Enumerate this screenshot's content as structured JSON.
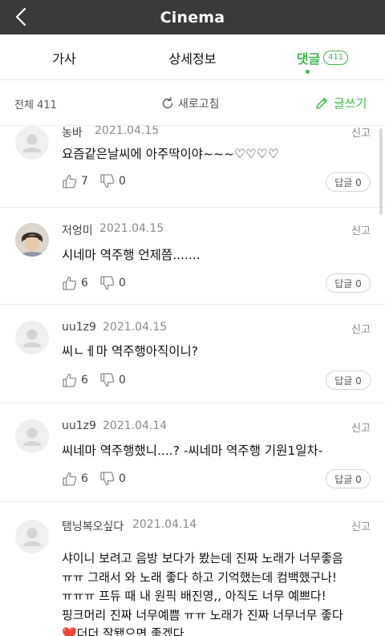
{
  "header": {
    "title": "Cinema"
  },
  "tabs": [
    {
      "label": "가사"
    },
    {
      "label": "상세정보"
    },
    {
      "label": "댓글",
      "count": "411"
    }
  ],
  "toolbar": {
    "total": "전체 411",
    "refresh": "새로고침",
    "write": "글쓰기"
  },
  "colors": {
    "accent": "#3dbb4a",
    "header_bg": "#3a3a3a"
  },
  "comments": [
    {
      "nick": "농바",
      "date": "2021.04.15",
      "report": "신고",
      "text": "요즘같은날씨에 아주딱이야~~~♡♡♡♡",
      "likes": "7",
      "dislikes": "0",
      "reply": "답글 0",
      "avatar": "default-avatar-icon"
    },
    {
      "nick": "저엉미",
      "date": "2021.04.15",
      "report": "신고",
      "text": "시네마 역주행 언제쯤.......",
      "likes": "6",
      "dislikes": "0",
      "reply": "답글 0",
      "avatar": "profile-photo"
    },
    {
      "nick": "uu1z9",
      "date": "2021.04.15",
      "report": "신고",
      "text": "씨ㄴㅔ마 역주행아직이니?",
      "likes": "6",
      "dislikes": "0",
      "reply": "답글 0",
      "avatar": "default-avatar-icon"
    },
    {
      "nick": "uu1z9",
      "date": "2021.04.14",
      "report": "신고",
      "text": "씨네마 역주행했니....? -씨네마 역주행 기원1일차-",
      "likes": "6",
      "dislikes": "0",
      "reply": "답글 0",
      "avatar": "default-avatar-icon"
    },
    {
      "nick": "탬닝복오싶다",
      "date": "2021.04.14",
      "report": "신고",
      "text_lines": [
        "샤이니 보려고 음방 보다가 봤는데 진짜 노래가 너무좋음",
        "ㅠㅠ 그래서 와 노래 좋다 하고 기억했는데 컴백했구나!",
        "ㅠㅠㅠ 프듀 때 내 원픽 배진영,, 아직도 너무 예쁘다!",
        "핑크머리 진짜 너무예쁨 ㅠㅠ 노래가 진짜 너무너무 좋다",
        "❤️더더 잘됐으면 좋겠다"
      ],
      "avatar": "default-avatar-icon"
    }
  ]
}
